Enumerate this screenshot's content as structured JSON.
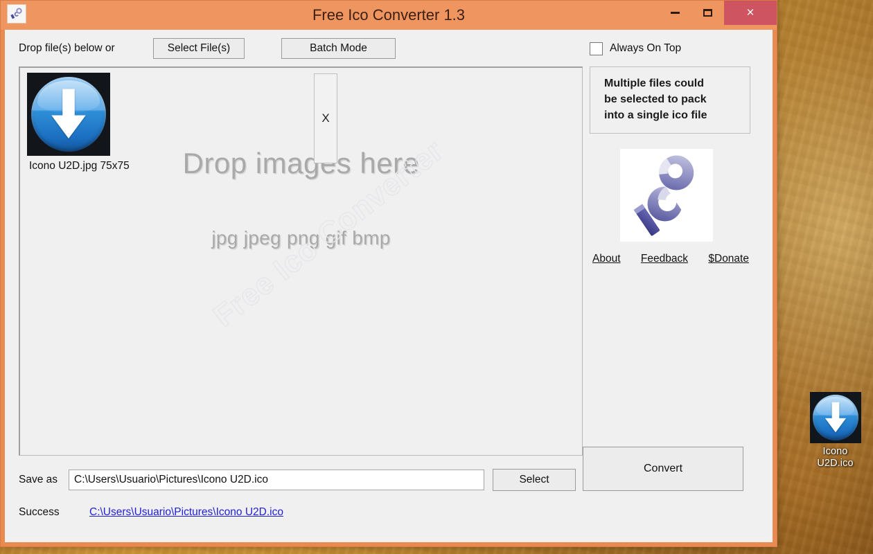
{
  "window": {
    "title": "Free Ico Converter 1.3",
    "app_icon": "ico-logo-icon",
    "controls": {
      "minimize": "minimize-icon",
      "maximize": "maximize-icon",
      "close": "×"
    },
    "accent_color": "#ef9660",
    "close_color": "#cd5460"
  },
  "toolbar": {
    "drop_label": "Drop file(s) below or",
    "select_files_label": "Select File(s)",
    "batch_mode_label": "Batch Mode"
  },
  "dropzone": {
    "hint_main": "Drop images here",
    "hint_formats": "jpg jpeg png gif bmp",
    "watermark": "Free Ico Converter",
    "remove_label": "X",
    "items": [
      {
        "filename": "Icono U2D.jpg",
        "dimensions": "75x75",
        "label": "Icono U2D.jpg  75x75",
        "thumb_icon": "blue-down-arrow-icon"
      }
    ]
  },
  "save_as": {
    "label": "Save as",
    "value": "C:\\Users\\Usuario\\Pictures\\Icono U2D.ico",
    "placeholder": "",
    "select_button_label": "Select"
  },
  "status": {
    "label": "Success",
    "link_text": "C:\\Users\\Usuario\\Pictures\\Icono U2D.ico",
    "link_color": "#2020d8"
  },
  "sidebar": {
    "always_on_top_label": "Always On Top",
    "always_on_top_checked": false,
    "info_text": "Multiple files could\nbe selected to pack\ninto a single ico file",
    "logo_alt": "ICO",
    "links": [
      {
        "label": "About",
        "name": "about-link"
      },
      {
        "label": "Feedback",
        "name": "feedback-link"
      },
      {
        "label": "$Donate",
        "name": "donate-link"
      }
    ],
    "convert_label": "Convert"
  },
  "desktop": {
    "icon": {
      "label_line1": "Icono",
      "label_line2": "U2D.ico",
      "icon_name": "blue-down-arrow-icon"
    }
  }
}
